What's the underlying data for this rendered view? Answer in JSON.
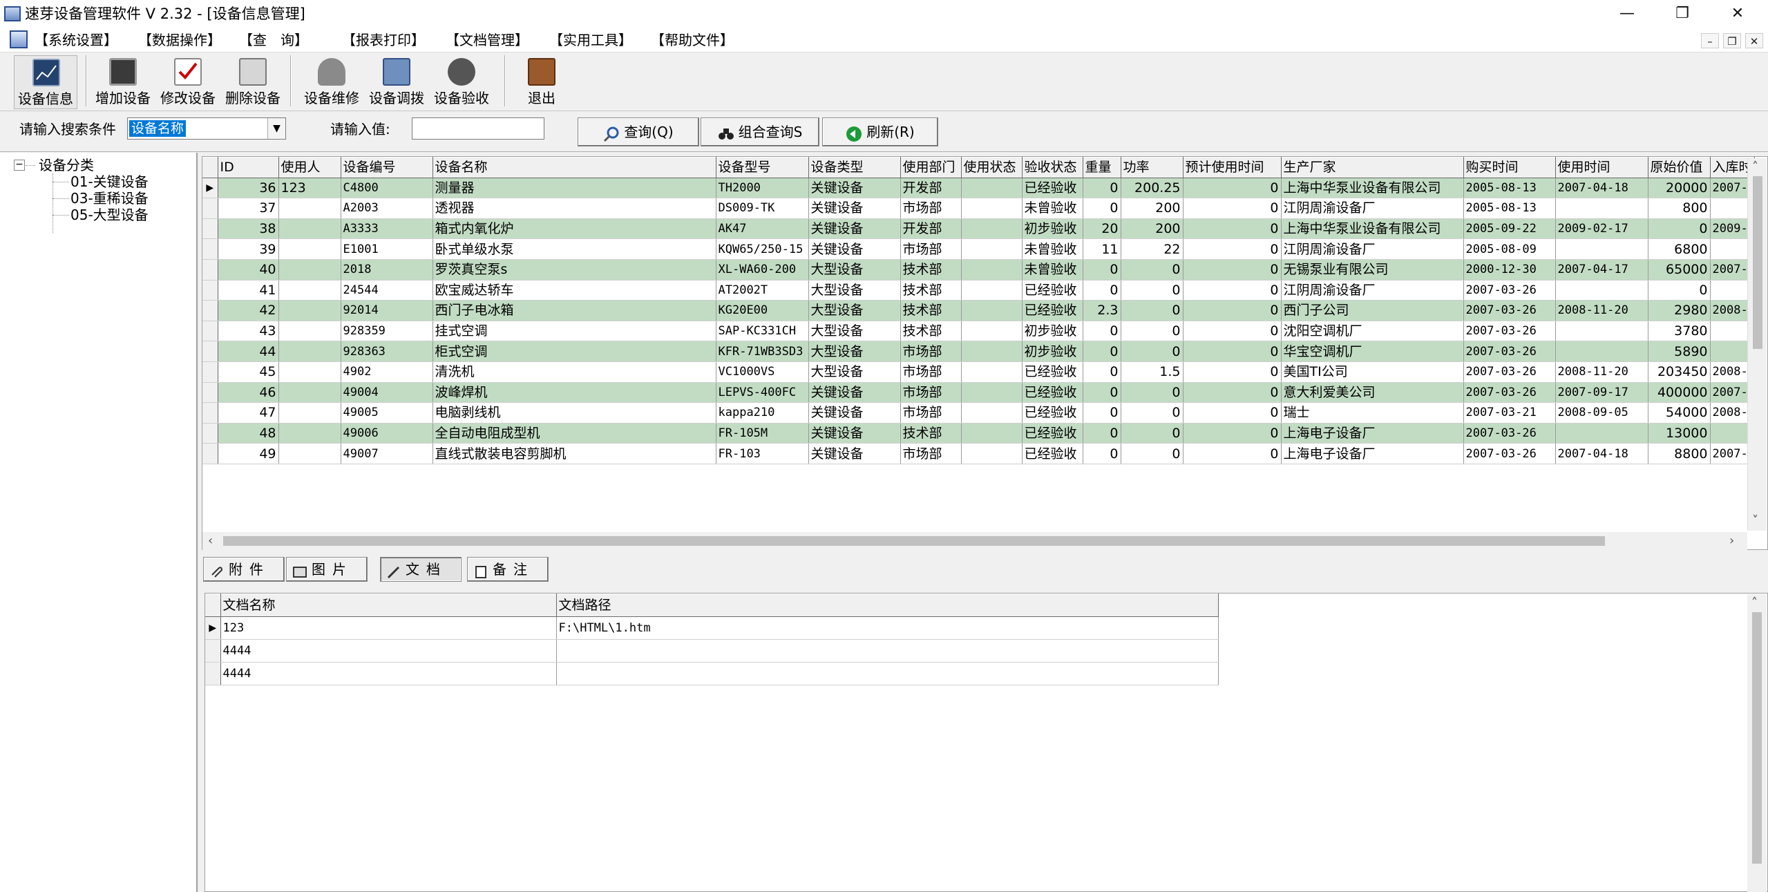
{
  "window": {
    "title": "速芽设备管理软件 V 2.32 - [设备信息管理]"
  },
  "menu": [
    "【系统设置】",
    "【数据操作】",
    "【查　询】",
    "【报表打印】",
    "【文档管理】",
    "【实用工具】",
    "【帮助文件】"
  ],
  "toolbar": {
    "device_info": "设备信息",
    "add_device": "增加设备",
    "edit_device": "修改设备",
    "delete_device": "删除设备",
    "repair": "设备维修",
    "transfer": "设备调拨",
    "acceptance": "设备验收",
    "exit": "退出"
  },
  "search": {
    "condition_label": "请输入搜索条件",
    "condition_value": "设备名称",
    "value_label": "请输入值:",
    "value_input": "",
    "query_button": "查询(Q)",
    "combo_query_button": "组合查询S",
    "refresh_button": "刷新(R)"
  },
  "tree": {
    "root": "设备分类",
    "children": [
      "01-关键设备",
      "03-重稀设备",
      "05-大型设备"
    ]
  },
  "grid": {
    "columns": [
      "ID",
      "使用人",
      "设备编号",
      "设备名称",
      "设备型号",
      "设备类型",
      "使用部门",
      "使用状态",
      "验收状态",
      "重量",
      "功率",
      "预计使用时间",
      "生产厂家",
      "购买时间",
      "使用时间",
      "原始价值",
      "入库时"
    ],
    "rows": [
      [
        "36",
        "123",
        "C4800",
        "测量器",
        "TH2000",
        "关键设备",
        "开发部",
        "",
        "已经验收",
        "0",
        "200.25",
        "0",
        "上海中华泵业设备有限公司",
        "2005-08-13",
        "2007-04-18",
        "20000",
        "2007-"
      ],
      [
        "37",
        "",
        "A2003",
        "透视器",
        "DS009-TK",
        "关键设备",
        "市场部",
        "",
        "未曾验收",
        "0",
        "200",
        "0",
        "江阴周渝设备厂",
        "2005-08-13",
        "",
        "800",
        ""
      ],
      [
        "38",
        "",
        "A3333",
        "箱式内氧化炉",
        "AK47",
        "关键设备",
        "开发部",
        "",
        "初步验收",
        "20",
        "200",
        "0",
        "上海中华泵业设备有限公司",
        "2005-09-22",
        "2009-02-17",
        "0",
        "2009-"
      ],
      [
        "39",
        "",
        "E1001",
        "卧式单级水泵",
        "KQW65/250-15",
        "关键设备",
        "市场部",
        "",
        "未曾验收",
        "11",
        "22",
        "0",
        "江阴周渝设备厂",
        "2005-08-09",
        "",
        "6800",
        ""
      ],
      [
        "40",
        "",
        "2018",
        "罗茨真空泵s",
        "XL-WA60-200",
        "大型设备",
        "技术部",
        "",
        "未曾验收",
        "0",
        "0",
        "0",
        "无锡泵业有限公司",
        "2000-12-30",
        "2007-04-17",
        "65000",
        "2007-"
      ],
      [
        "41",
        "",
        "24544",
        "欧宝威达轿车",
        "AT2002T",
        "大型设备",
        "技术部",
        "",
        "已经验收",
        "0",
        "0",
        "0",
        "江阴周渝设备厂",
        "2007-03-26",
        "",
        "0",
        ""
      ],
      [
        "42",
        "",
        "92014",
        "西门子电冰箱",
        "KG20E00",
        "大型设备",
        "技术部",
        "",
        "已经验收",
        "2.3",
        "0",
        "0",
        "西门子公司",
        "2007-03-26",
        "2008-11-20",
        "2980",
        "2008-"
      ],
      [
        "43",
        "",
        "928359",
        "挂式空调",
        "SAP-KC331CH",
        "大型设备",
        "技术部",
        "",
        "初步验收",
        "0",
        "0",
        "0",
        "沈阳空调机厂",
        "2007-03-26",
        "",
        "3780",
        ""
      ],
      [
        "44",
        "",
        "928363",
        "柜式空调",
        "KFR-71WB3SD3",
        "大型设备",
        "市场部",
        "",
        "初步验收",
        "0",
        "0",
        "0",
        "华宝空调机厂",
        "2007-03-26",
        "",
        "5890",
        ""
      ],
      [
        "45",
        "",
        "4902",
        "清洗机",
        "VC1000VS",
        "大型设备",
        "市场部",
        "",
        "已经验收",
        "0",
        "1.5",
        "0",
        "美国TI公司",
        "2007-03-26",
        "2008-11-20",
        "203450",
        "2008-"
      ],
      [
        "46",
        "",
        "49004",
        "波峰焊机",
        "LEPVS-400FC",
        "关键设备",
        "市场部",
        "",
        "已经验收",
        "0",
        "0",
        "0",
        "意大利爱美公司",
        "2007-03-26",
        "2007-09-17",
        "400000",
        "2007-"
      ],
      [
        "47",
        "",
        "49005",
        "电脑剥线机",
        "kappa210",
        "关键设备",
        "市场部",
        "",
        "已经验收",
        "0",
        "0",
        "0",
        "瑞士",
        "2007-03-21",
        "2008-09-05",
        "54000",
        "2008-"
      ],
      [
        "48",
        "",
        "49006",
        "全自动电阻成型机",
        "FR-105M",
        "关键设备",
        "技术部",
        "",
        "已经验收",
        "0",
        "0",
        "0",
        "上海电子设备厂",
        "2007-03-26",
        "",
        "13000",
        ""
      ],
      [
        "49",
        "",
        "49007",
        "直线式散装电容剪脚机",
        "FR-103",
        "关键设备",
        "市场部",
        "",
        "已经验收",
        "0",
        "0",
        "0",
        "上海电子设备厂",
        "2007-03-26",
        "2007-04-18",
        "8800",
        "2007-"
      ]
    ]
  },
  "tabs": [
    "附件",
    "图片",
    "文档",
    "备注"
  ],
  "docs": {
    "columns": [
      "文档名称",
      "文档路径"
    ],
    "rows": [
      [
        "123",
        "F:\\HTML\\1.htm"
      ],
      [
        "4444",
        ""
      ],
      [
        "4444",
        ""
      ]
    ]
  }
}
